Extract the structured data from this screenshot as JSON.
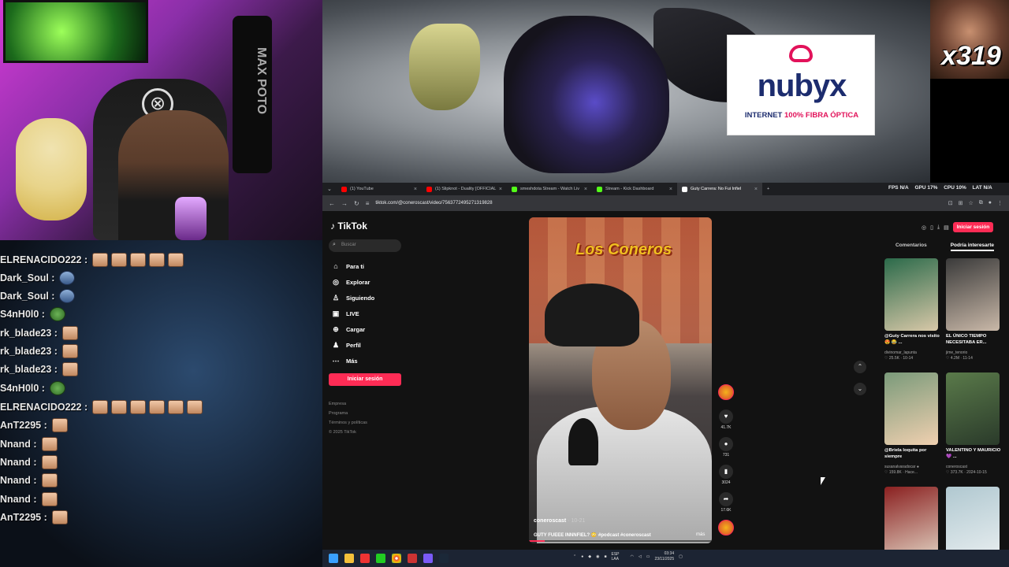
{
  "webcam": {
    "bag_text": "MAX POTO",
    "chair_logo": "⊗"
  },
  "chat": {
    "lines": [
      {
        "user": "ELRENACIDO222 :",
        "emote": "peach",
        "count": 5
      },
      {
        "user": "Dark_Soul :",
        "emote": "blue",
        "count": 1
      },
      {
        "user": "Dark_Soul :",
        "emote": "blue",
        "count": 1
      },
      {
        "user": "S4nH0l0 :",
        "emote": "pepe",
        "count": 1
      },
      {
        "user": "rk_blade23 :",
        "emote": "peach",
        "count": 1
      },
      {
        "user": "rk_blade23 :",
        "emote": "peach",
        "count": 1
      },
      {
        "user": "rk_blade23 :",
        "emote": "peach",
        "count": 1
      },
      {
        "user": "S4nH0l0 :",
        "emote": "pepe",
        "count": 1
      },
      {
        "user": "ELRENACIDO222 :",
        "emote": "peach",
        "count": 6
      },
      {
        "user": "AnT2295 :",
        "emote": "peach",
        "count": 1
      },
      {
        "user": "Nnand :",
        "emote": "peach",
        "count": 1
      },
      {
        "user": "Nnand :",
        "emote": "peach",
        "count": 1
      },
      {
        "user": "Nnand :",
        "emote": "peach",
        "count": 1
      },
      {
        "user": "Nnand :",
        "emote": "peach",
        "count": 1
      },
      {
        "user": "AnT2295 :",
        "emote": "peach",
        "count": 1
      }
    ]
  },
  "ad": {
    "brand": "nubyx",
    "tag_pre": "INTERNET ",
    "tag_hl": "100% FIBRA ÓPTICA",
    "accent": "#e2125a",
    "navy": "#1c2c6e"
  },
  "meme": {
    "count": "x319"
  },
  "browser": {
    "tabs": [
      {
        "label": "(1) YouTube",
        "color": "#ff0000"
      },
      {
        "label": "(1) Slipknot - Duality [OFFICIAL",
        "color": "#ff0000"
      },
      {
        "label": "smeshdota Stream - Watch Liv",
        "color": "#53fc18"
      },
      {
        "label": "Stream - Kick Dashboard",
        "color": "#53fc18"
      },
      {
        "label": "Guty Carrera: No Fui Infiel",
        "color": "#ffffff"
      }
    ],
    "perf": {
      "fps": "FPS N/A",
      "gpu": "GPU 17%",
      "cpu": "CPU 10%",
      "lat": "LAT N/A"
    },
    "url": "tiktok.com/@coneroscast/video/7563772495271319828"
  },
  "tiktok": {
    "logo": "TikTok",
    "search_placeholder": "Buscar",
    "nav": [
      "Para ti",
      "Explorar",
      "Siguiendo",
      "LIVE",
      "Cargar",
      "Perfil",
      "Más"
    ],
    "login": "Iniciar sesión",
    "footer": [
      "Empresa",
      "Programa",
      "Términos y políticas",
      "© 2025 TikTok"
    ],
    "video": {
      "overlay_logo": "Los Coneros",
      "author": "coneroscast",
      "date": " · 10-21",
      "desc": "GUTY FUEEE INNNFIEL? 😳 #podcast #coneroscast",
      "more": "más"
    },
    "actions": {
      "likes": "41.7K",
      "comments": "731",
      "saves": "3024",
      "shares": "17.6K"
    },
    "right": {
      "login": "Iniciar sesión",
      "tab1": "Comentarios",
      "tab2": "Podría interesarte",
      "items": [
        {
          "title": "@Guty Carrera nos visito 😍 😂 ...",
          "author": "divinomar_lapunta",
          "stats": "♡ 25.5K · 10-14",
          "c1": "#2b6a4a",
          "c2": "#d8c8a8"
        },
        {
          "title": "EL ÚNICO TIEMPO NECESITABA ER...",
          "author": "jime_tenorio",
          "stats": "♡ 4.2M · 11-14",
          "c1": "#3a3a3a",
          "c2": "#c9b8a8"
        },
        {
          "title": "@Briela loquita por siempre",
          "author": "susanalvaradocar ●",
          "stats": "♡ 159.8K · Hace...",
          "c1": "#7a9a7a",
          "c2": "#f0d0b0"
        },
        {
          "title": "VALENTINO Y MAURICIO 💜 ...",
          "author": "coneroscast",
          "stats": "♡ 373.7K · 2024-10-15",
          "c1": "#5a7a4a",
          "c2": "#2a3a2a"
        },
        {
          "title": "",
          "author": "",
          "stats": "",
          "c1": "#8a2020",
          "c2": "#e0d0c0"
        },
        {
          "title": "",
          "author": "",
          "stats": "",
          "c1": "#b0c8d0",
          "c2": "#e8eef0"
        }
      ]
    }
  },
  "taskbar": {
    "lang": "ESP LAA",
    "time": "03:34",
    "date": "23/11/2025"
  }
}
